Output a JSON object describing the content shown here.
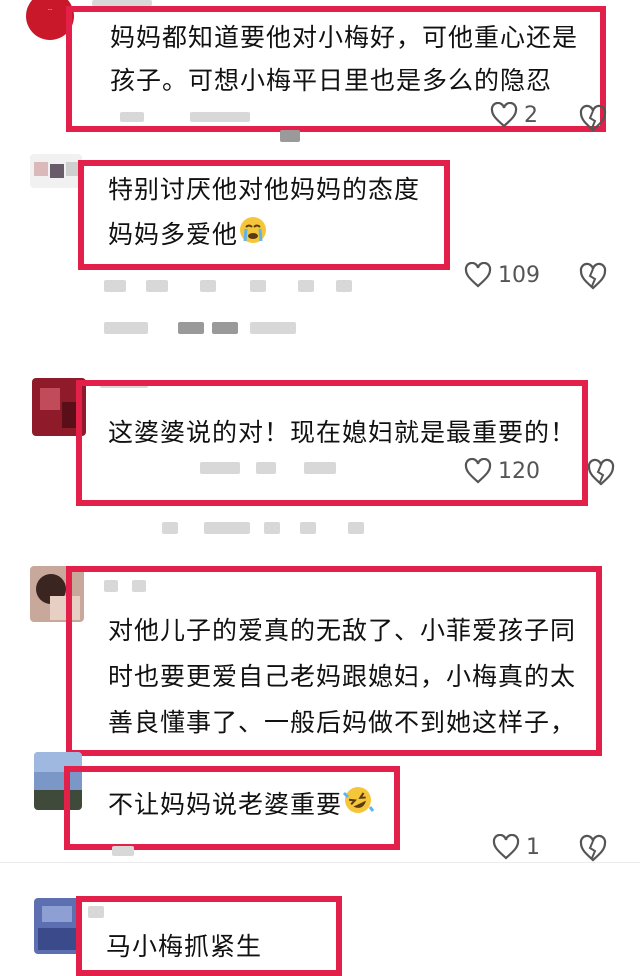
{
  "comments": [
    {
      "text_lines": [
        "妈妈都知道要他对小梅好，可他重心还是",
        "孩子。可想小梅平日里也是多么的隐忍"
      ],
      "likes": "2"
    },
    {
      "text_lines": [
        "特别讨厌他对他妈妈的态度",
        "妈妈多爱他"
      ],
      "emoji": "crying-face",
      "likes": "109"
    },
    {
      "text_lines": [
        "这婆婆说的对！现在媳妇就是最重要的！"
      ],
      "likes": "120"
    },
    {
      "text_lines": [
        "对他儿子的爱真的无敌了、小菲爱孩子同",
        "时也要更爱自己老妈跟媳妇，小梅真的太",
        "善良懂事了、一般后妈做不到她这样子，"
      ]
    },
    {
      "text_lines": [
        "不让妈妈说老婆重要"
      ],
      "emoji": "rolling-laughing-face",
      "likes": "1"
    },
    {
      "text_lines": [
        "马小梅抓紧生"
      ]
    }
  ],
  "colors": {
    "highlight_border": "#e2204a",
    "text": "#111111",
    "meta": "#555555"
  }
}
